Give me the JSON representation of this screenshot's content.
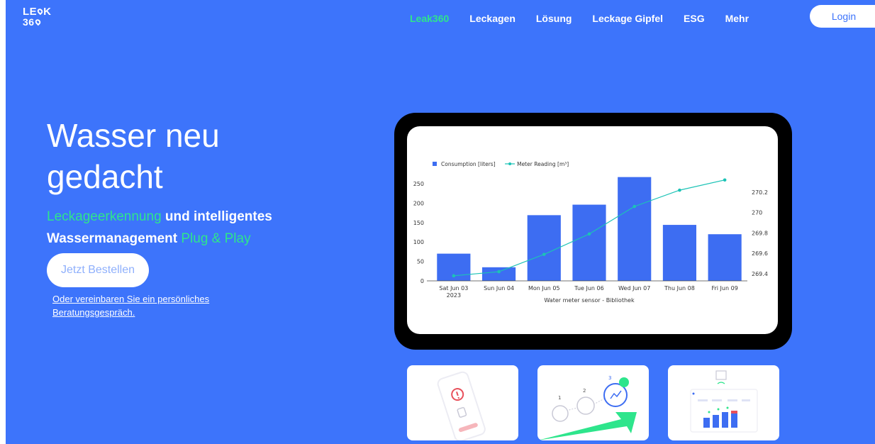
{
  "logo": {
    "line1": "LE",
    "line1b": "K",
    "line2": "36"
  },
  "nav": {
    "items": [
      {
        "label": "Leak360",
        "active": true
      },
      {
        "label": "Leckagen",
        "active": false
      },
      {
        "label": "Lösung",
        "active": false
      },
      {
        "label": "Leckage Gipfel",
        "active": false
      },
      {
        "label": "ESG",
        "active": false
      },
      {
        "label": "Mehr",
        "active": false
      }
    ],
    "login_label": "Login"
  },
  "hero": {
    "title": "Wasser neu gedacht",
    "sub_green1": "Leckageerkennung",
    "sub_white1": " und intelligentes",
    "sub_white2": "Wassermanagement ",
    "sub_green2": "Plug & Play",
    "order_label": "Jetzt Bestellen",
    "consult_label": "Oder vereinbaren Sie ein persönliches Beratungsgespräch."
  },
  "colors": {
    "background": "#3d74fb",
    "accent_green": "#2ee58c",
    "bar": "#3d6df2",
    "line": "#1cc3b6"
  },
  "cards": [
    {
      "icon": "phone-alert-icon"
    },
    {
      "icon": "setup-steps-icon"
    },
    {
      "icon": "dashboard-bars-icon"
    }
  ],
  "chart_data": {
    "type": "bar",
    "categories": [
      "Sat Jun 03",
      "Sun Jun 04",
      "Mon Jun 05",
      "Tue Jun 06",
      "Wed Jun 07",
      "Thu Jun 08",
      "Fri Jun 09"
    ],
    "category_sublabel_first": "2023",
    "series": [
      {
        "name": "Consumption  [liters]",
        "type": "bar",
        "axis": "left",
        "values": [
          70,
          35,
          169,
          196,
          267,
          144,
          120
        ]
      },
      {
        "name": "Meter Reading  [m³]",
        "type": "line",
        "axis": "right",
        "values": [
          269.38,
          269.42,
          269.59,
          269.79,
          270.06,
          270.22,
          270.32
        ]
      }
    ],
    "xlabel": "Water meter sensor - Bibliothek",
    "ylim": [
      0,
      270
    ],
    "yticks": [
      0,
      50,
      100,
      150,
      200,
      250
    ],
    "y2lim": [
      269.33,
      270.36
    ],
    "y2ticks": [
      269.4,
      269.6,
      269.8,
      270,
      270.2
    ],
    "y2tick_labels": [
      "269.4",
      "269.6",
      "269.8",
      "270",
      "270.2"
    ],
    "legend_position": "top-left",
    "grid": false
  }
}
